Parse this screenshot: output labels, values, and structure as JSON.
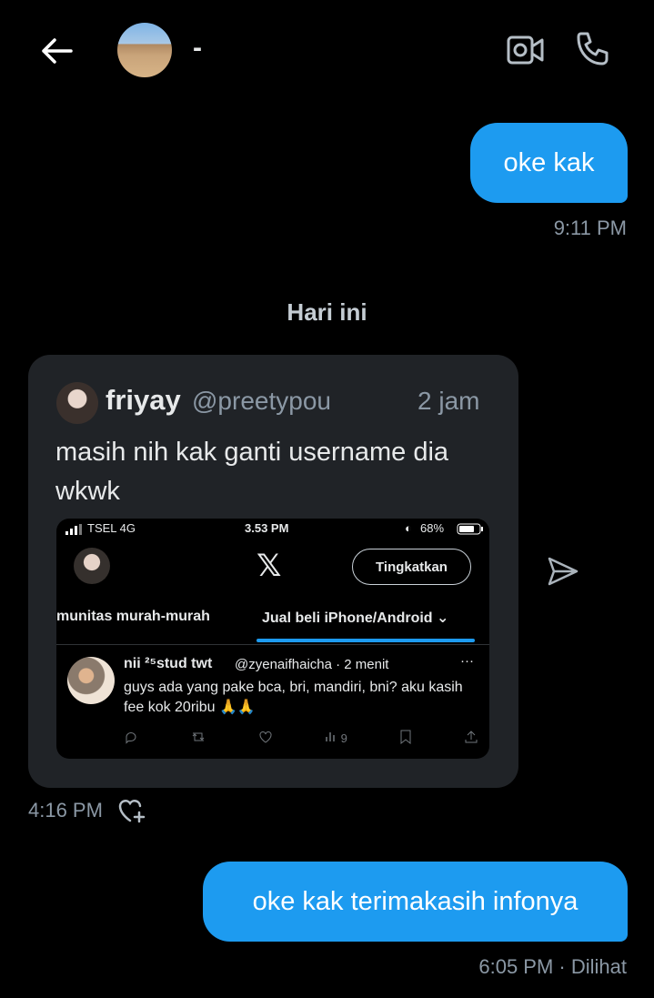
{
  "header": {
    "contact_name": "-",
    "back_icon": "arrow-left-icon",
    "video_icon": "video-camera-icon",
    "call_icon": "phone-icon"
  },
  "messages": [
    {
      "direction": "out",
      "text": "oke kak",
      "time": "9:11 PM"
    },
    {
      "day_separator": "Hari ini"
    },
    {
      "direction": "in",
      "shared_post": {
        "author": "friyay",
        "handle": "@preetypou",
        "age": "2 jam",
        "text": "masih nih kak ganti username dia wkwk",
        "screenshot": {
          "status_carrier": "TSEL  4G",
          "status_time": "3.53 PM",
          "status_battery": "68%",
          "logo": "𝕏",
          "upgrade_label": "Tingkatkan",
          "tabs": [
            "munitas murah-murah",
            "Jual beli iPhone/Android ⌄"
          ],
          "tweet": {
            "author": "nii ²⁵stud twt",
            "meta": "@zyenaifhaicha · 2 menit",
            "more": "···",
            "text": "guys ada yang pake bca, bri, mandiri, bni? aku kasih fee kok 20ribu 🙏🙏",
            "views": "9"
          }
        }
      },
      "time": "4:16 PM"
    },
    {
      "direction": "out",
      "text": "oke kak terimakasih infonya",
      "time": "6:05 PM · Dilihat"
    }
  ],
  "colors": {
    "bubble_out": "#1d9bf0",
    "card_bg": "#202327",
    "muted": "#8b98a5"
  }
}
